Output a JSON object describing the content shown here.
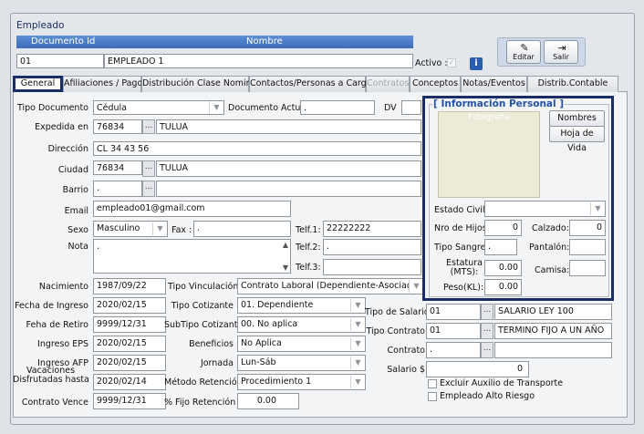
{
  "window_title": "Empleado",
  "header": {
    "doc_id_label": "Documento Id",
    "nombre_label": "Nombre",
    "doc_id_value": "01",
    "nombre_value": "EMPLEADO 1",
    "activo_label": "Activo :",
    "edit_label": "Editar",
    "exit_label": "Salir"
  },
  "tabs": [
    "General",
    "Afiliaciones / Pago",
    "Distribución Clase Nomina",
    "Contactos/Personas a Cargo",
    "Contratos",
    "Conceptos",
    "Notas/Eventos",
    "Distrib.Contable"
  ],
  "form": {
    "tipo_documento_label": "Tipo Documento",
    "tipo_documento": "Cédula",
    "documento_actual_label": "Documento Actual",
    "documento_actual": ".",
    "dv_label": "DV",
    "expedida_label": "Expedida en",
    "expedida_code": "76834",
    "expedida_city": "TULUA",
    "direccion_label": "Dirección",
    "direccion": "CL 34 43 56",
    "ciudad_label": "Ciudad",
    "ciudad_code": "76834",
    "ciudad_name": "TULUA",
    "barrio_label": "Barrio",
    "barrio": ".",
    "email_label": "Email",
    "email": "empleado01@gmail.com",
    "sexo_label": "Sexo",
    "sexo": "Masculino",
    "fax_label": "Fax :",
    "fax": ".",
    "telf1_label": "Telf.1:",
    "telf1": "22222222",
    "telf2_label": "Telf.2:",
    "telf2": ".",
    "telf3_label": "Telf.3:",
    "telf3": "",
    "nota_label": "Nota",
    "nota": ".",
    "nacimiento_label": "Nacimiento",
    "nacimiento": "1987/09/22",
    "fecha_ingreso_label": "Fecha de Ingreso",
    "fecha_ingreso": "2020/02/15",
    "fecha_retiro_label": "Feha de Retiro",
    "fecha_retiro": "9999/12/31",
    "ingreso_eps_label": "Ingreso EPS",
    "ingreso_eps": "2020/02/15",
    "ingreso_afp_label": "Ingreso AFP",
    "ingreso_afp": "2020/02/15",
    "vacaciones_label_1": "Vacaciones",
    "vacaciones_label_2": "Disfrutadas hasta",
    "vacaciones": "2020/02/14",
    "contrato_vence_label": "Contrato Vence",
    "contrato_vence": "9999/12/31",
    "tipo_vinculacion_label": "Tipo Vinculación",
    "tipo_vinculacion": "Contrato Laboral (Dependiente-Asociado)",
    "tipo_cotizante_label": "Tipo Cotizante",
    "tipo_cotizante": "01. Dependiente",
    "subtipo_cotizante_label": "SubTipo Cotizante",
    "subtipo_cotizante": "00. No aplica",
    "beneficios_label": "Beneficios",
    "beneficios": "No Aplica",
    "jornada_label": "Jornada",
    "jornada": "Lun-Sáb",
    "metodo_retencion_label": "Método Retención",
    "metodo_retencion": "Procedimiento 1",
    "fijo_retencion_label": "% Fijo Retención",
    "fijo_retencion": "0.00",
    "tipo_salario_label": "Tipo de Salario",
    "tipo_salario_code": "01",
    "tipo_salario_name": "SALARIO LEY 100",
    "tipo_contrato_label": "Tipo Contrato",
    "tipo_contrato_code": "01",
    "tipo_contrato_name": "TERMINO FIJO A UN AÑO",
    "contrato_label": "Contrato",
    "contrato": ".",
    "salario_label": "Salario $",
    "salario": "0",
    "excluir_label": "Excluir Auxilio de Transporte",
    "alto_riesgo_label": "Empleado Alto Riesgo"
  },
  "info_personal": {
    "title": "[ Información Personal ]",
    "foto_label": "Fotografia",
    "nombres_btn": "Nombres",
    "hoja_vida_btn": "Hoja de Vida",
    "estado_civil_label": "Estado Civil:",
    "estado_civil": "",
    "hijos_label": "Nro de Hijos",
    "hijos": "0",
    "calzado_label": "Calzado:",
    "calzado": "0",
    "tipo_sangre_label": "Tipo Sangre:",
    "tipo_sangre": ".",
    "pantalon_label": "Pantalón:",
    "pantalon": "",
    "estatura_label_1": "Estatura",
    "estatura_label_2": "(MTS):",
    "estatura": "0.00",
    "camisa_label": "Camisa:",
    "camisa": "",
    "peso_label": "Peso(KL):",
    "peso": "0.00"
  },
  "colors": {
    "header_blue": "#3c6cb9",
    "highlight_navy": "#1a2d66"
  }
}
